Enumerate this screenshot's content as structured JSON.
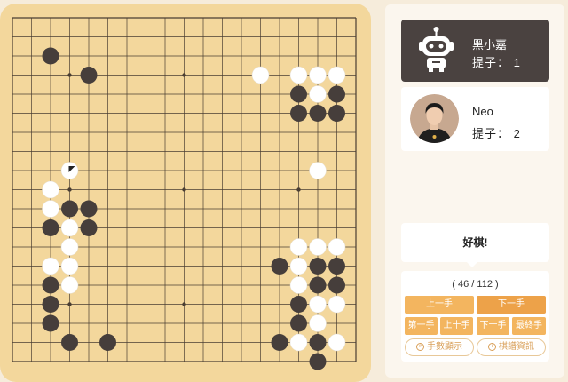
{
  "board": {
    "size": 19,
    "background": "#f3d79c",
    "line_color": "#4a3e33",
    "black_color": "#463e3b",
    "white_color": "#ffffff",
    "star_points": [
      [
        3,
        3
      ],
      [
        9,
        3
      ],
      [
        15,
        3
      ],
      [
        3,
        9
      ],
      [
        9,
        9
      ],
      [
        15,
        9
      ],
      [
        3,
        15
      ],
      [
        9,
        15
      ],
      [
        15,
        15
      ]
    ],
    "black_stones": [
      [
        2,
        2
      ],
      [
        4,
        3
      ],
      [
        15,
        4
      ],
      [
        17,
        4
      ],
      [
        15,
        5
      ],
      [
        16,
        5
      ],
      [
        17,
        5
      ],
      [
        3,
        10
      ],
      [
        4,
        10
      ],
      [
        2,
        11
      ],
      [
        4,
        11
      ],
      [
        2,
        14
      ],
      [
        16,
        13
      ],
      [
        17,
        13
      ],
      [
        16,
        14
      ],
      [
        17,
        14
      ],
      [
        2,
        15
      ],
      [
        15,
        15
      ],
      [
        14,
        13
      ],
      [
        15,
        16
      ],
      [
        2,
        16
      ],
      [
        3,
        17
      ],
      [
        5,
        17
      ],
      [
        14,
        17
      ],
      [
        16,
        17
      ],
      [
        16,
        18
      ]
    ],
    "white_stones": [
      [
        13,
        3
      ],
      [
        15,
        3
      ],
      [
        16,
        3
      ],
      [
        17,
        3
      ],
      [
        16,
        4
      ],
      [
        3,
        8
      ],
      [
        16,
        8
      ],
      [
        2,
        9
      ],
      [
        2,
        10
      ],
      [
        3,
        11
      ],
      [
        3,
        12
      ],
      [
        2,
        13
      ],
      [
        3,
        13
      ],
      [
        3,
        14
      ],
      [
        15,
        12
      ],
      [
        16,
        12
      ],
      [
        17,
        12
      ],
      [
        15,
        13
      ],
      [
        16,
        15
      ],
      [
        17,
        15
      ],
      [
        15,
        14
      ],
      [
        16,
        16
      ],
      [
        15,
        17
      ],
      [
        17,
        17
      ]
    ],
    "last_move": [
      3,
      8
    ]
  },
  "players": {
    "bot": {
      "name": "黑小嘉",
      "captures_label": "提子：",
      "captures": "1",
      "avatar": "robot-icon"
    },
    "human": {
      "name": "Neo",
      "captures_label": "提子：",
      "captures": "2",
      "avatar": "user-photo"
    }
  },
  "comment": "好棋!",
  "controls": {
    "move_counter": "( 46 / 112 )",
    "prev_move": "上一手",
    "next_move": "下一手",
    "first_move": "第一手",
    "back_ten": "上十手",
    "forward_ten": "下十手",
    "last_move": "最終手",
    "show_move_numbers": "手數顯示",
    "game_info": "棋譜資訊"
  },
  "colors": {
    "accent": "#f3b55f",
    "accent_dark": "#eda249",
    "panel_dark": "#4a4240"
  }
}
